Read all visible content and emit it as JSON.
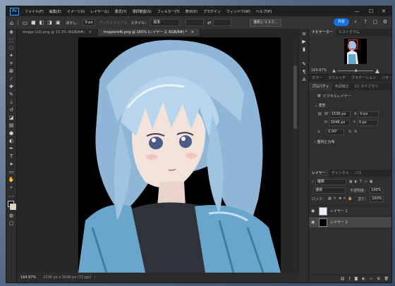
{
  "menu": {
    "logo": "Ps",
    "items": [
      "ファイル(F)",
      "編集(E)",
      "イメージ(I)",
      "レイヤー(L)",
      "書式(Y)",
      "選択範囲(S)",
      "フィルター(T)",
      "表示(V)",
      "プラグイン",
      "ウィンドウ(W)",
      "ヘルプ(H)"
    ]
  },
  "window_controls": {
    "minimize": "—",
    "maximize": "☐",
    "close": "✕"
  },
  "options": {
    "feather_label": "ぼかし：",
    "feather_value": "0 px",
    "antialias_label": "アンチエイリアス",
    "style_label": "スタイル：",
    "style_value": "標準",
    "select_mask_label": "選択とマスク...",
    "share_label": "共有"
  },
  "tabs": [
    {
      "label": "image (10).png @ 33.3% (RGB/8#)",
      "close": "×"
    },
    {
      "label": "tmppiorefb.png @ 165% (レイヤー 2, RGB/8#) *",
      "close": "×"
    }
  ],
  "status": {
    "zoom": "164.87%",
    "doc_info": "1536 px x 2048 px (72 ppi)"
  },
  "panel": {
    "top_tabs": [
      "ナビゲーター",
      "ヒストグラム"
    ],
    "nav_zoom": "164.87%",
    "mid_tabs": [
      "カラー",
      "スウォッチ",
      "グラデーション",
      "パターン"
    ],
    "prop_tabs": [
      "プロパティ",
      "色調補正",
      "CC ライブラリ"
    ],
    "prop_kind": "ピクセルレイヤー",
    "transform_label": "変形",
    "w_label": "W",
    "w_value": "1536 px",
    "x_label": "X",
    "x_value": "0 px",
    "h_label": "H",
    "h_value": "2048 px",
    "y_label": "Y",
    "y_value": "0 px",
    "angle_value": "0.00°",
    "align_label": "整列と分布",
    "layer_tabs": [
      "レイヤー",
      "チャンネル",
      "パス"
    ],
    "filter_label": "種類",
    "blend_mode": "通常",
    "opacity_label": "不透明度：",
    "opacity_value": "100%",
    "lock_label": "ロック：",
    "fill_label": "塗り：",
    "fill_value": "100%",
    "layers": [
      {
        "name": "レイヤー 1",
        "thumb": "#e8eef5"
      },
      {
        "name": "レイヤー 2",
        "thumb": "#000000"
      }
    ]
  },
  "colors": {
    "accent": "#1473e6",
    "nav_frame": "#ff2a2a"
  }
}
